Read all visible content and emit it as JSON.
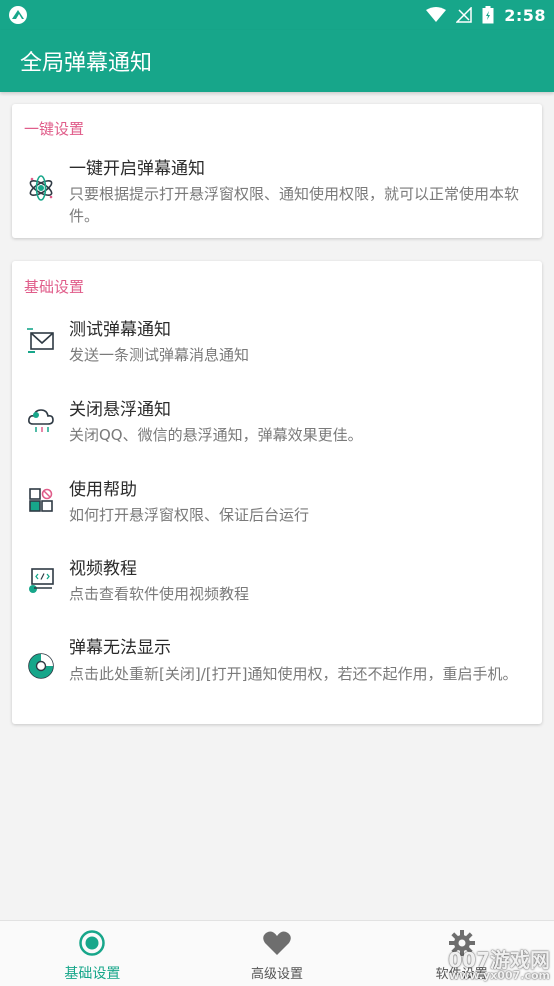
{
  "status_bar": {
    "time": "2:58"
  },
  "app_bar": {
    "title": "全局弹幕通知"
  },
  "quick_section": {
    "header": "一键设置",
    "items": [
      {
        "title": "一键开启弹幕通知",
        "subtitle": "只要根据提示打开悬浮窗权限、通知使用权限，就可以正常使用本软件。",
        "icon": "atom-icon"
      }
    ]
  },
  "basic_section": {
    "header": "基础设置",
    "items": [
      {
        "title": "测试弹幕通知",
        "subtitle": "发送一条测试弹幕消息通知",
        "icon": "mail-icon"
      },
      {
        "title": "关闭悬浮通知",
        "subtitle": "关闭QQ、微信的悬浮通知，弹幕效果更佳。",
        "icon": "cloud-icon"
      },
      {
        "title": "使用帮助",
        "subtitle": "如何打开悬浮窗权限、保证后台运行",
        "icon": "blocks-icon"
      },
      {
        "title": "视频教程",
        "subtitle": "点击查看软件使用视频教程",
        "icon": "video-icon"
      },
      {
        "title": "弹幕无法显示",
        "subtitle": "点击此处重新[关闭]/[打开]通知使用权，若还不起作用，重启手机。",
        "icon": "pie-icon"
      }
    ]
  },
  "bottom_nav": {
    "items": [
      {
        "label": "基础设置",
        "icon": "radio-target-icon",
        "active": true
      },
      {
        "label": "高级设置",
        "icon": "heart-icon",
        "active": false
      },
      {
        "label": "软件设置",
        "icon": "gear-icon",
        "active": false
      }
    ]
  },
  "watermark": {
    "text": "007游戏网",
    "url": "www.yx007.com"
  },
  "colors": {
    "primary": "#17a68a",
    "accent_text": "#e05d8a",
    "background": "#f3f3f3"
  }
}
